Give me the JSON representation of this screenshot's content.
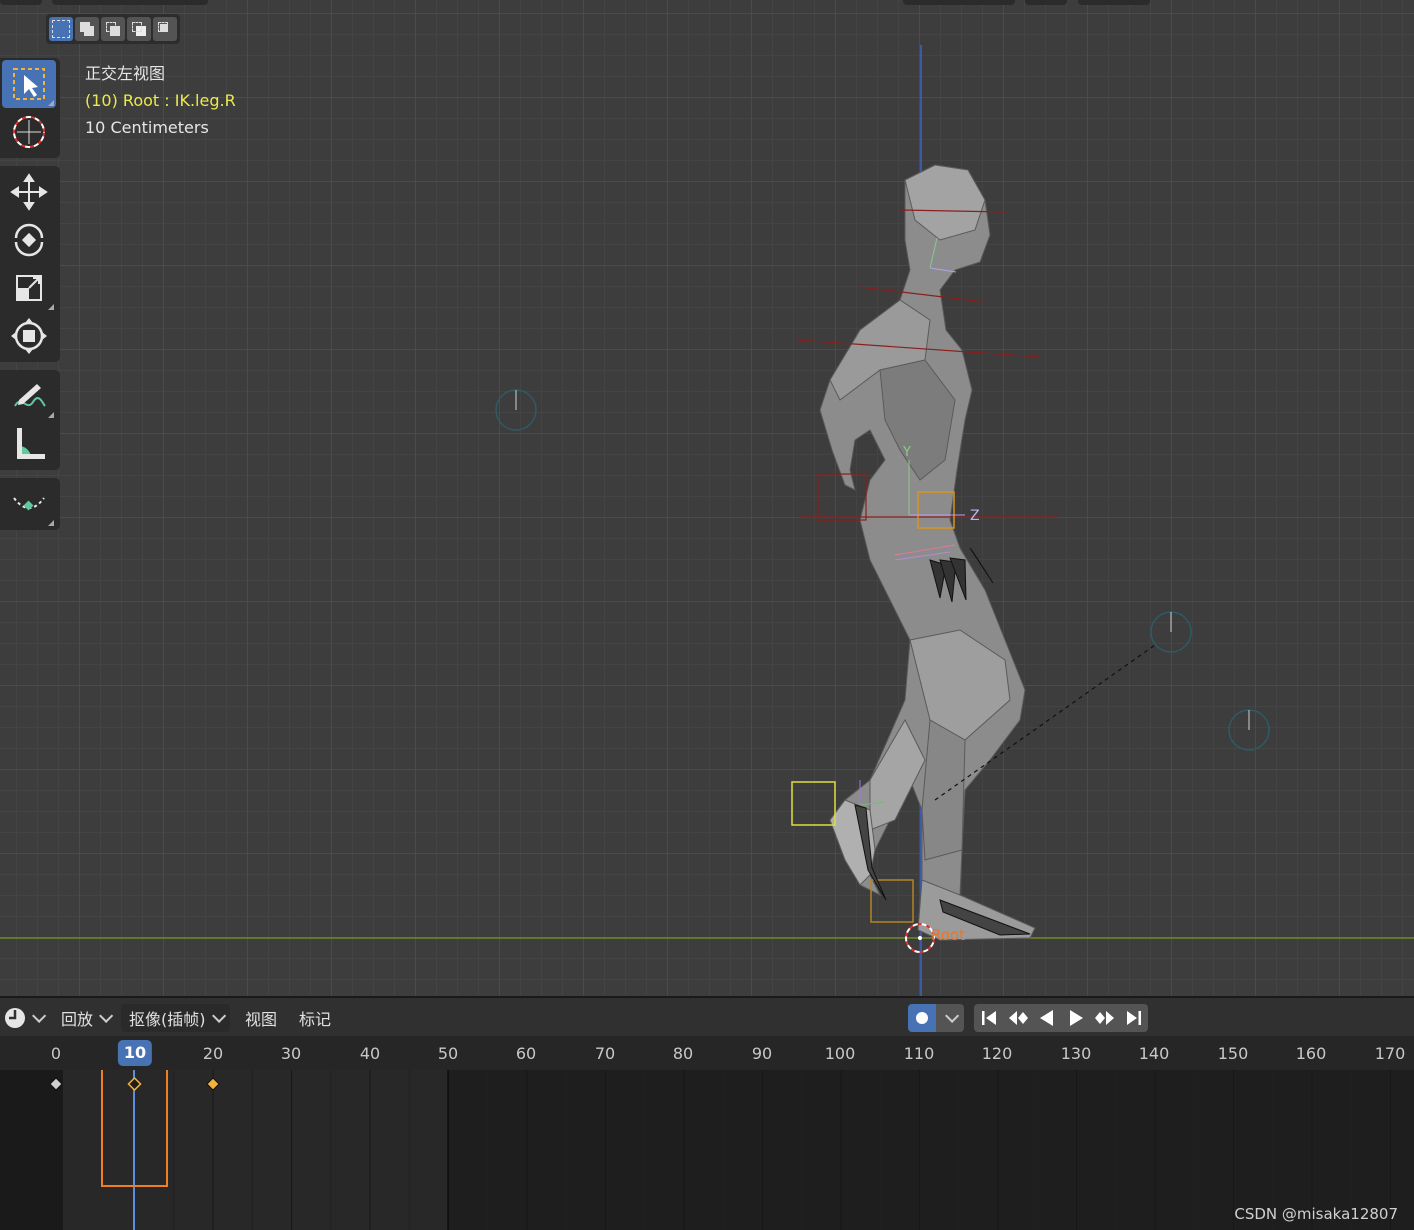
{
  "viewport": {
    "view_name": "正交左视图",
    "active_object": "(10) Root : IK.leg.R",
    "grid_scale": "10 Centimeters",
    "root_bone_label": "Root",
    "axis_labels": {
      "y": "Y",
      "z": "Z"
    },
    "select_modes": [
      "select-set-icon",
      "select-extend-icon",
      "select-subtract-icon",
      "select-invert-icon",
      "select-intersect-icon"
    ],
    "tools": [
      "select-box-icon",
      "cursor-icon",
      "move-icon",
      "rotate-icon",
      "scale-icon",
      "transform-icon",
      "annotate-icon",
      "measure-icon",
      "pose-relax-icon"
    ]
  },
  "timeline": {
    "menu": {
      "playback": "回放",
      "keying": "抠像(插帧)",
      "view": "视图",
      "marker": "标记"
    },
    "current_frame": "10",
    "ruler_labels": [
      "0",
      "20",
      "30",
      "40",
      "50",
      "60",
      "70",
      "80",
      "90",
      "100",
      "110",
      "120",
      "130",
      "140",
      "150",
      "160",
      "170"
    ],
    "transport": [
      "jump-start-icon",
      "prev-keyframe-icon",
      "play-reverse-icon",
      "play-icon",
      "next-keyframe-icon",
      "jump-end-icon"
    ],
    "keyframe_frames": [
      0,
      10,
      20
    ]
  },
  "watermark": "CSDN @misaka12807",
  "colors": {
    "accent": "#4772b3",
    "highlight": "#eaea4c",
    "annotation_box": "#f07f24",
    "keyframe": "#f5b23a"
  }
}
